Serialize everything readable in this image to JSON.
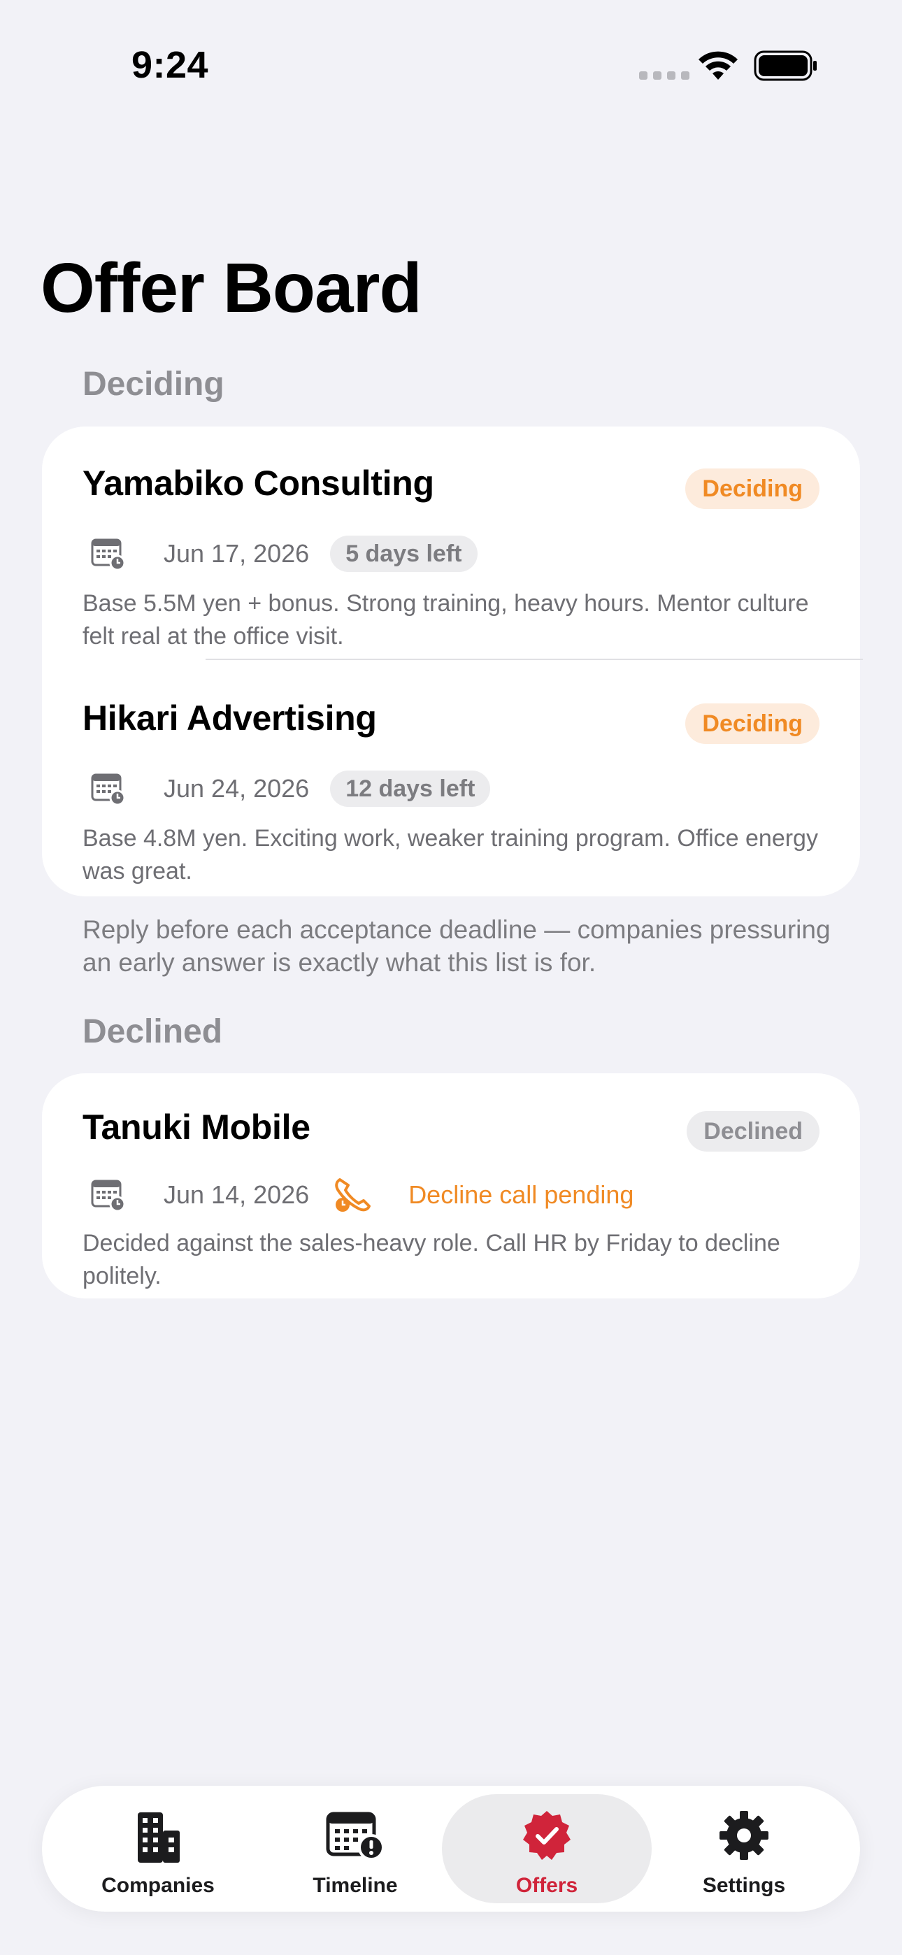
{
  "status_bar": {
    "time": "9:24"
  },
  "page": {
    "title": "Offer Board"
  },
  "sections": {
    "deciding": {
      "header": "Deciding",
      "footer": "Reply before each acceptance deadline — companies pressuring an early answer is exactly what this list is for.",
      "items": [
        {
          "company": "Yamabiko Consulting",
          "status": "Deciding",
          "date": "Jun 17, 2026",
          "days_left": "5 days left",
          "note": "Base 5.5M yen + bonus. Strong training, heavy hours. Mentor culture felt real at the office visit."
        },
        {
          "company": "Hikari Advertising",
          "status": "Deciding",
          "date": "Jun 24, 2026",
          "days_left": "12 days left",
          "note": "Base 4.8M yen. Exciting work, weaker training program. Office energy was great."
        }
      ]
    },
    "declined": {
      "header": "Declined",
      "items": [
        {
          "company": "Tanuki Mobile",
          "status": "Declined",
          "date": "Jun 14, 2026",
          "pending": "Decline call pending",
          "note": "Decided against the sales-heavy role. Call HR by Friday to decline politely."
        }
      ]
    }
  },
  "tabbar": {
    "tabs": [
      {
        "label": "Companies",
        "icon": "building-icon"
      },
      {
        "label": "Timeline",
        "icon": "calendar-alert-icon"
      },
      {
        "label": "Offers",
        "icon": "checkmark-seal-icon",
        "active": true
      },
      {
        "label": "Settings",
        "icon": "gear-icon"
      }
    ]
  },
  "colors": {
    "accent": "#d0243a",
    "deciding": "#f08a24",
    "background": "#f2f2f7"
  }
}
